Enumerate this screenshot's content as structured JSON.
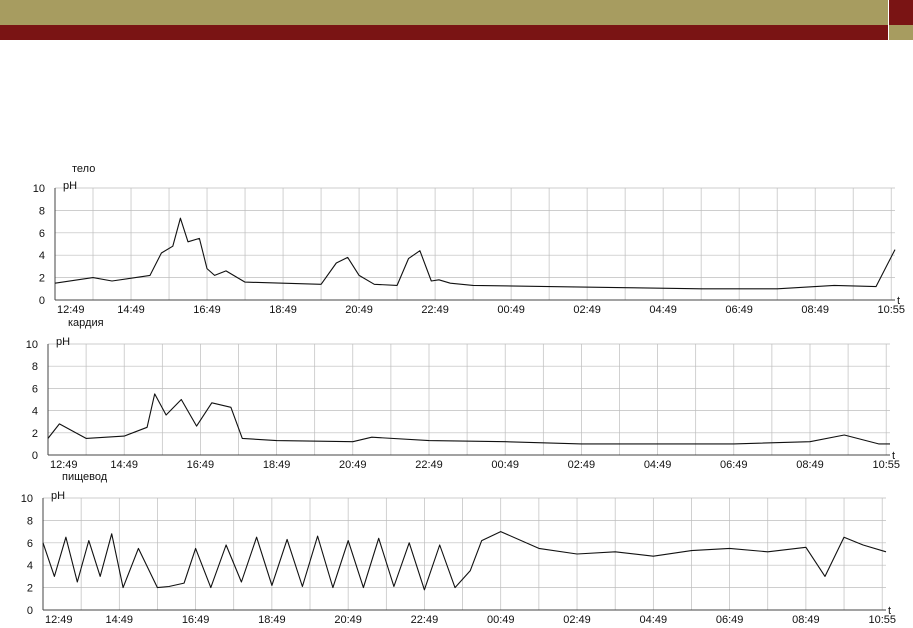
{
  "header": {
    "primary_color": "#a79c60",
    "accent_color": "#7a1414"
  },
  "chart_data": [
    {
      "type": "line",
      "title": "тело",
      "ylabel": "pH",
      "ylim": [
        0,
        10
      ],
      "yticks": [
        "0",
        "2",
        "4",
        "6",
        "8",
        "10"
      ],
      "xticks": [
        "12:49",
        "14:49",
        "16:49",
        "18:49",
        "20:49",
        "22:49",
        "00:49",
        "02:49",
        "04:49",
        "06:49",
        "08:49",
        "10:55"
      ],
      "x_axis_symbol": "t",
      "x_hours": [
        0,
        1,
        1.5,
        2.5,
        2.8,
        3.1,
        3.3,
        3.5,
        3.8,
        4,
        4.2,
        4.5,
        5,
        6,
        7,
        7.4,
        7.7,
        8,
        8.4,
        9,
        9.3,
        9.6,
        9.9,
        10.1,
        10.4,
        11,
        13,
        15,
        17,
        19,
        20.5,
        21.6,
        22.1
      ],
      "series": [
        {
          "values": [
            1.5,
            2.0,
            1.7,
            2.2,
            4.2,
            4.8,
            7.3,
            5.2,
            5.5,
            2.8,
            2.2,
            2.6,
            1.6,
            1.5,
            1.4,
            3.3,
            3.8,
            2.2,
            1.4,
            1.3,
            3.7,
            4.4,
            1.7,
            1.8,
            1.5,
            1.3,
            1.2,
            1.1,
            1.0,
            1.0,
            1.3,
            1.2,
            4.5
          ]
        }
      ]
    },
    {
      "type": "line",
      "title": "кардия",
      "ylabel": "pH",
      "ylim": [
        0,
        10
      ],
      "yticks": [
        "0",
        "2",
        "4",
        "6",
        "8",
        "10"
      ],
      "xticks": [
        "12:49",
        "14:49",
        "16:49",
        "18:49",
        "20:49",
        "22:49",
        "00:49",
        "02:49",
        "04:49",
        "06:49",
        "08:49",
        "10:55"
      ],
      "x_axis_symbol": "t",
      "x_hours": [
        0,
        0.3,
        1,
        2,
        2.6,
        2.8,
        3.1,
        3.5,
        3.9,
        4.3,
        4.8,
        5.1,
        6,
        8,
        8.5,
        10,
        12,
        14,
        16,
        18,
        20,
        20.9,
        21.8,
        22.1
      ],
      "series": [
        {
          "values": [
            1.5,
            2.8,
            1.5,
            1.7,
            2.5,
            5.5,
            3.6,
            5.0,
            2.6,
            4.7,
            4.3,
            1.5,
            1.3,
            1.2,
            1.6,
            1.3,
            1.2,
            1.0,
            1.0,
            1.0,
            1.2,
            1.8,
            1.0,
            1.0
          ]
        }
      ]
    },
    {
      "type": "line",
      "title": "пищевод",
      "ylabel": "pH",
      "ylim": [
        0,
        10
      ],
      "yticks": [
        "0",
        "2",
        "4",
        "6",
        "8",
        "10"
      ],
      "xticks": [
        "12:49",
        "14:49",
        "16:49",
        "18:49",
        "20:49",
        "22:49",
        "00:49",
        "02:49",
        "04:49",
        "06:49",
        "08:49",
        "10:55"
      ],
      "x_axis_symbol": "t",
      "x_hours": [
        0,
        0.3,
        0.6,
        0.9,
        1.2,
        1.5,
        1.8,
        2.1,
        2.5,
        3,
        3.3,
        3.7,
        4,
        4.4,
        4.8,
        5.2,
        5.6,
        6,
        6.4,
        6.8,
        7.2,
        7.6,
        8,
        8.4,
        8.8,
        9.2,
        9.6,
        10,
        10.4,
        10.8,
        11.2,
        11.5,
        12,
        13,
        14,
        15,
        16,
        17,
        18,
        19,
        20,
        20.5,
        21,
        21.5,
        22.1
      ],
      "series": [
        {
          "values": [
            6.0,
            3.0,
            6.5,
            2.5,
            6.2,
            3.0,
            6.8,
            2.0,
            5.5,
            2.0,
            2.1,
            2.4,
            5.5,
            2.0,
            5.8,
            2.5,
            6.5,
            2.2,
            6.3,
            2.1,
            6.6,
            2.0,
            6.2,
            2.0,
            6.4,
            2.1,
            6.0,
            1.8,
            5.8,
            2.0,
            3.5,
            6.2,
            7.0,
            5.5,
            5.0,
            5.2,
            4.8,
            5.3,
            5.5,
            5.2,
            5.6,
            3.0,
            6.5,
            5.8,
            5.2
          ]
        }
      ]
    }
  ]
}
